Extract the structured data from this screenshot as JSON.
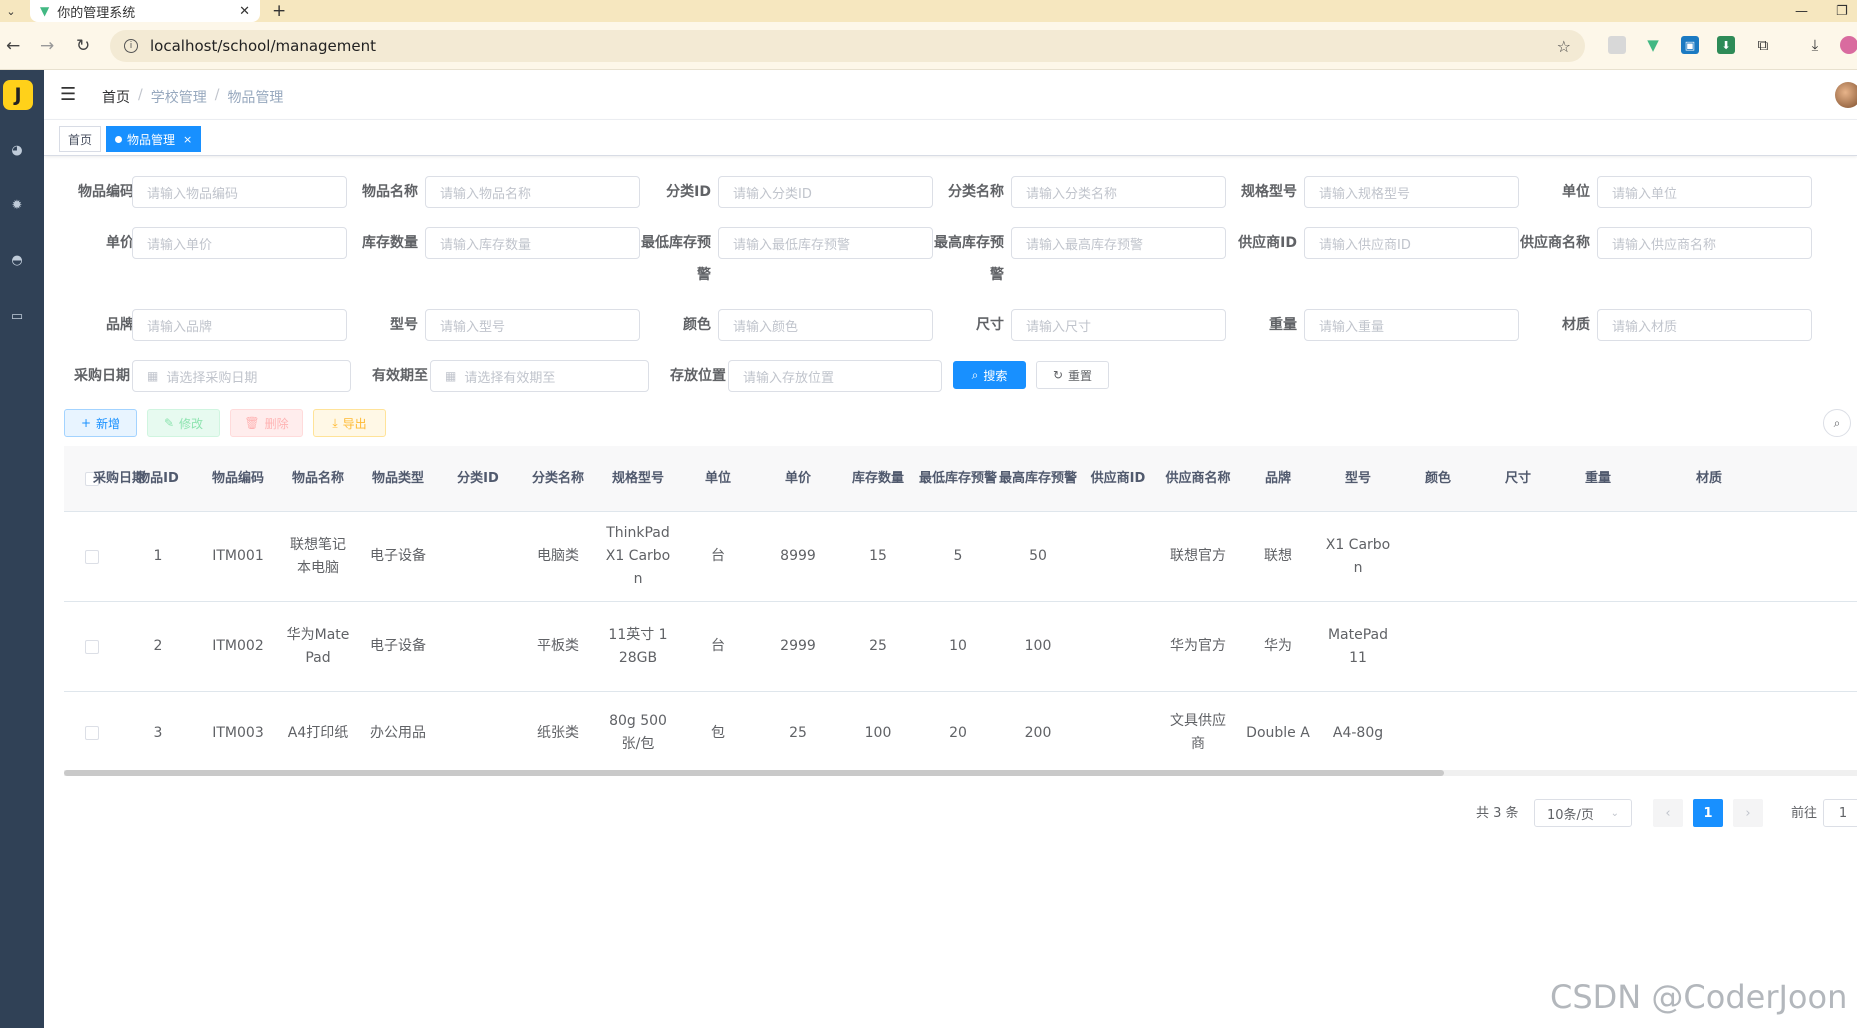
{
  "browser": {
    "tab_title": "你的管理系统",
    "url": "localhost/school/management"
  },
  "breadcrumb": {
    "home": "首页",
    "level1": "学校管理",
    "level2": "物品管理"
  },
  "tags": {
    "home": "首页",
    "active": "物品管理"
  },
  "search": {
    "fields": [
      {
        "label": "物品编码",
        "placeholder": "请输入物品编码"
      },
      {
        "label": "物品名称",
        "placeholder": "请输入物品名称"
      },
      {
        "label": "分类ID",
        "placeholder": "请输入分类ID"
      },
      {
        "label": "分类名称",
        "placeholder": "请输入分类名称"
      },
      {
        "label": "规格型号",
        "placeholder": "请输入规格型号"
      },
      {
        "label": "单位",
        "placeholder": "请输入单位"
      },
      {
        "label": "单价",
        "placeholder": "请输入单价"
      },
      {
        "label": "库存数量",
        "placeholder": "请输入库存数量"
      },
      {
        "label": "最低库存预警",
        "placeholder": "请输入最低库存预警"
      },
      {
        "label": "最高库存预警",
        "placeholder": "请输入最高库存预警"
      },
      {
        "label": "供应商ID",
        "placeholder": "请输入供应商ID"
      },
      {
        "label": "供应商名称",
        "placeholder": "请输入供应商名称"
      },
      {
        "label": "品牌",
        "placeholder": "请输入品牌"
      },
      {
        "label": "型号",
        "placeholder": "请输入型号"
      },
      {
        "label": "颜色",
        "placeholder": "请输入颜色"
      },
      {
        "label": "尺寸",
        "placeholder": "请输入尺寸"
      },
      {
        "label": "重量",
        "placeholder": "请输入重量"
      },
      {
        "label": "材质",
        "placeholder": "请输入材质"
      },
      {
        "label": "采购日期",
        "placeholder": "请选择采购日期"
      },
      {
        "label": "有效期至",
        "placeholder": "请选择有效期至"
      },
      {
        "label": "存放位置",
        "placeholder": "请输入存放位置"
      }
    ],
    "search_label": "搜索",
    "reset_label": "重置"
  },
  "toolbar": {
    "add": "新增",
    "edit": "修改",
    "delete": "删除",
    "export": "导出"
  },
  "table": {
    "columns": [
      "物品ID",
      "物品编码",
      "物品名称",
      "物品类型",
      "分类ID",
      "分类名称",
      "规格型号",
      "单位",
      "单价",
      "库存数量",
      "最低库存预警",
      "最高库存预警",
      "供应商ID",
      "供应商名称",
      "品牌",
      "型号",
      "颜色",
      "尺寸",
      "重量",
      "材质",
      "采购日期"
    ],
    "rows": [
      [
        "1",
        "ITM001",
        "联想笔记本电脑",
        "电子设备",
        "",
        "电脑类",
        "ThinkPad X1 Carbon",
        "台",
        "8999",
        "15",
        "5",
        "50",
        "",
        "联想官方",
        "联想",
        "X1 Carbon",
        "",
        "",
        "",
        "",
        ""
      ],
      [
        "2",
        "ITM002",
        "华为MatePad",
        "电子设备",
        "",
        "平板类",
        "11英寸 128GB",
        "台",
        "2999",
        "25",
        "10",
        "100",
        "",
        "华为官方",
        "华为",
        "MatePad 11",
        "",
        "",
        "",
        "",
        ""
      ],
      [
        "3",
        "ITM003",
        "A4打印纸",
        "办公用品",
        "",
        "纸张类",
        "80g 500张/包",
        "包",
        "25",
        "100",
        "20",
        "200",
        "",
        "文具供应商",
        "Double A",
        "A4-80g",
        "",
        "",
        "",
        "",
        ""
      ]
    ]
  },
  "pagination": {
    "total": "共 3 条",
    "page_size": "10条/页",
    "current": "1",
    "goto_label": "前往",
    "goto_value": "1"
  },
  "watermark": "CSDN @CoderJoon"
}
